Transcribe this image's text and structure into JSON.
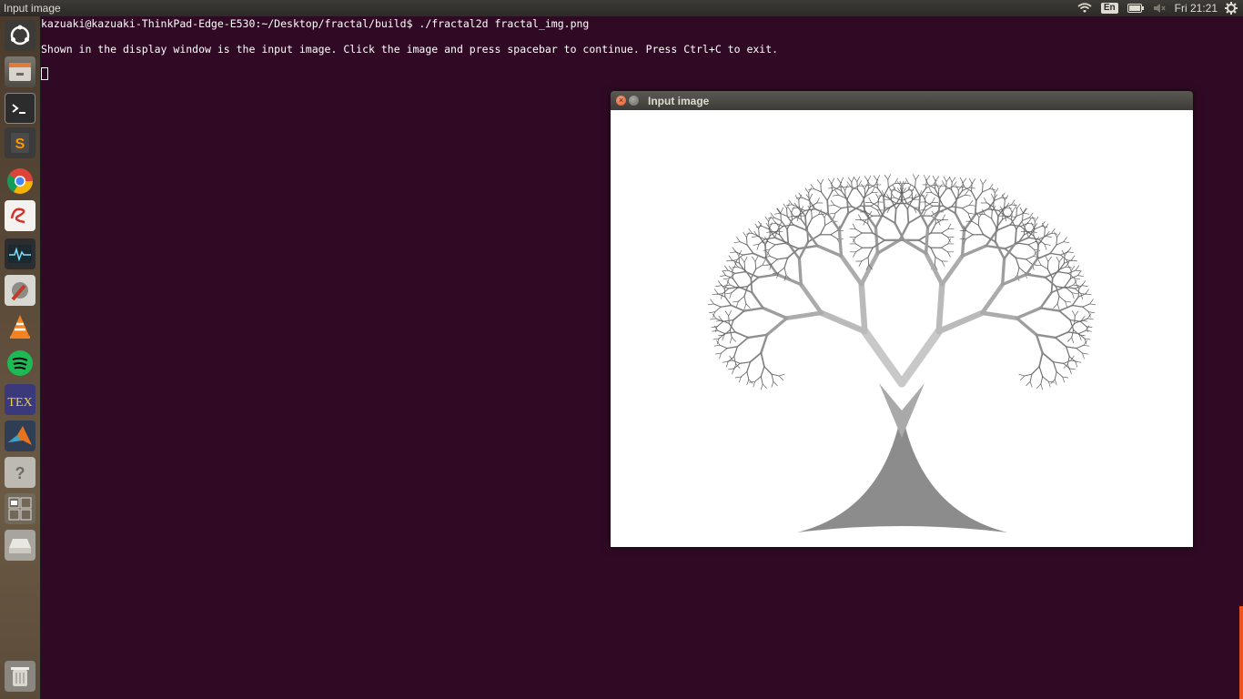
{
  "top_panel": {
    "window_title": "Input image",
    "keyboard_layout": "En",
    "clock": "Fri 21:21",
    "icons": [
      "wifi-icon",
      "battery-icon",
      "volume-icon",
      "gear-icon"
    ]
  },
  "launcher": {
    "items": [
      {
        "name": "dash-icon"
      },
      {
        "name": "files-icon"
      },
      {
        "name": "terminal-icon"
      },
      {
        "name": "sublime-text-icon"
      },
      {
        "name": "chrome-icon"
      },
      {
        "name": "evince-icon"
      },
      {
        "name": "system-monitor-icon"
      },
      {
        "name": "settings-icon"
      },
      {
        "name": "vlc-icon"
      },
      {
        "name": "spotify-icon"
      },
      {
        "name": "texmaker-icon"
      },
      {
        "name": "matlab-icon"
      },
      {
        "name": "help-icon"
      },
      {
        "name": "workspace-switcher-icon"
      },
      {
        "name": "drive-icon"
      },
      {
        "name": "trash-icon"
      }
    ]
  },
  "terminal": {
    "prompt_line": "kazuaki@kazuaki-ThinkPad-Edge-E530:~/Desktop/fractal/build$ ./fractal2d fractal_img.png",
    "output_line": "Shown in the display window is the input image. Click the image and press spacebar to continue. Press Ctrl+C to exit."
  },
  "image_window": {
    "title": "Input image",
    "close_glyph": "×"
  },
  "colors": {
    "terminal_bg": "#300a24",
    "accent": "#e95420"
  }
}
